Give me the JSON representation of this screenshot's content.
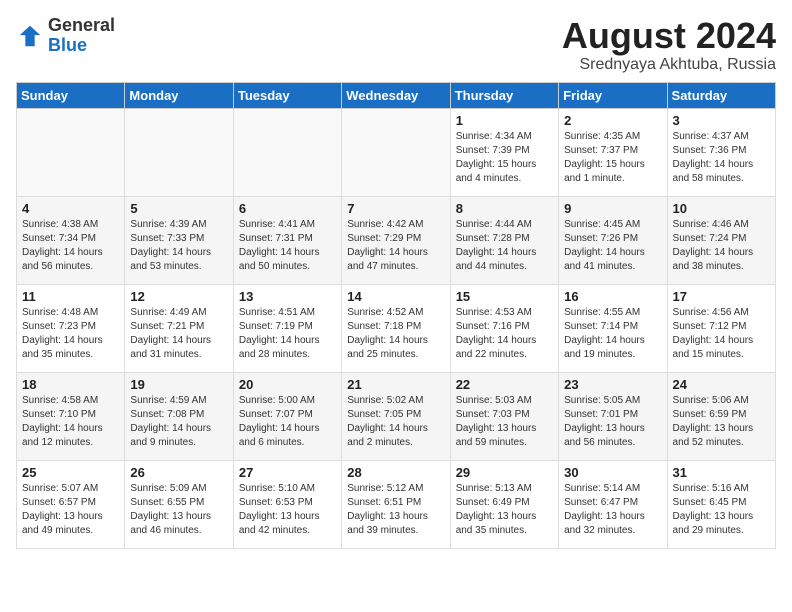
{
  "header": {
    "logo": {
      "general": "General",
      "blue": "Blue"
    },
    "month": "August 2024",
    "location": "Srednyaya Akhtuba, Russia"
  },
  "days_of_week": [
    "Sunday",
    "Monday",
    "Tuesday",
    "Wednesday",
    "Thursday",
    "Friday",
    "Saturday"
  ],
  "weeks": [
    [
      {
        "num": "",
        "info": ""
      },
      {
        "num": "",
        "info": ""
      },
      {
        "num": "",
        "info": ""
      },
      {
        "num": "",
        "info": ""
      },
      {
        "num": "1",
        "info": "Sunrise: 4:34 AM\nSunset: 7:39 PM\nDaylight: 15 hours\nand 4 minutes."
      },
      {
        "num": "2",
        "info": "Sunrise: 4:35 AM\nSunset: 7:37 PM\nDaylight: 15 hours\nand 1 minute."
      },
      {
        "num": "3",
        "info": "Sunrise: 4:37 AM\nSunset: 7:36 PM\nDaylight: 14 hours\nand 58 minutes."
      }
    ],
    [
      {
        "num": "4",
        "info": "Sunrise: 4:38 AM\nSunset: 7:34 PM\nDaylight: 14 hours\nand 56 minutes."
      },
      {
        "num": "5",
        "info": "Sunrise: 4:39 AM\nSunset: 7:33 PM\nDaylight: 14 hours\nand 53 minutes."
      },
      {
        "num": "6",
        "info": "Sunrise: 4:41 AM\nSunset: 7:31 PM\nDaylight: 14 hours\nand 50 minutes."
      },
      {
        "num": "7",
        "info": "Sunrise: 4:42 AM\nSunset: 7:29 PM\nDaylight: 14 hours\nand 47 minutes."
      },
      {
        "num": "8",
        "info": "Sunrise: 4:44 AM\nSunset: 7:28 PM\nDaylight: 14 hours\nand 44 minutes."
      },
      {
        "num": "9",
        "info": "Sunrise: 4:45 AM\nSunset: 7:26 PM\nDaylight: 14 hours\nand 41 minutes."
      },
      {
        "num": "10",
        "info": "Sunrise: 4:46 AM\nSunset: 7:24 PM\nDaylight: 14 hours\nand 38 minutes."
      }
    ],
    [
      {
        "num": "11",
        "info": "Sunrise: 4:48 AM\nSunset: 7:23 PM\nDaylight: 14 hours\nand 35 minutes."
      },
      {
        "num": "12",
        "info": "Sunrise: 4:49 AM\nSunset: 7:21 PM\nDaylight: 14 hours\nand 31 minutes."
      },
      {
        "num": "13",
        "info": "Sunrise: 4:51 AM\nSunset: 7:19 PM\nDaylight: 14 hours\nand 28 minutes."
      },
      {
        "num": "14",
        "info": "Sunrise: 4:52 AM\nSunset: 7:18 PM\nDaylight: 14 hours\nand 25 minutes."
      },
      {
        "num": "15",
        "info": "Sunrise: 4:53 AM\nSunset: 7:16 PM\nDaylight: 14 hours\nand 22 minutes."
      },
      {
        "num": "16",
        "info": "Sunrise: 4:55 AM\nSunset: 7:14 PM\nDaylight: 14 hours\nand 19 minutes."
      },
      {
        "num": "17",
        "info": "Sunrise: 4:56 AM\nSunset: 7:12 PM\nDaylight: 14 hours\nand 15 minutes."
      }
    ],
    [
      {
        "num": "18",
        "info": "Sunrise: 4:58 AM\nSunset: 7:10 PM\nDaylight: 14 hours\nand 12 minutes."
      },
      {
        "num": "19",
        "info": "Sunrise: 4:59 AM\nSunset: 7:08 PM\nDaylight: 14 hours\nand 9 minutes."
      },
      {
        "num": "20",
        "info": "Sunrise: 5:00 AM\nSunset: 7:07 PM\nDaylight: 14 hours\nand 6 minutes."
      },
      {
        "num": "21",
        "info": "Sunrise: 5:02 AM\nSunset: 7:05 PM\nDaylight: 14 hours\nand 2 minutes."
      },
      {
        "num": "22",
        "info": "Sunrise: 5:03 AM\nSunset: 7:03 PM\nDaylight: 13 hours\nand 59 minutes."
      },
      {
        "num": "23",
        "info": "Sunrise: 5:05 AM\nSunset: 7:01 PM\nDaylight: 13 hours\nand 56 minutes."
      },
      {
        "num": "24",
        "info": "Sunrise: 5:06 AM\nSunset: 6:59 PM\nDaylight: 13 hours\nand 52 minutes."
      }
    ],
    [
      {
        "num": "25",
        "info": "Sunrise: 5:07 AM\nSunset: 6:57 PM\nDaylight: 13 hours\nand 49 minutes."
      },
      {
        "num": "26",
        "info": "Sunrise: 5:09 AM\nSunset: 6:55 PM\nDaylight: 13 hours\nand 46 minutes."
      },
      {
        "num": "27",
        "info": "Sunrise: 5:10 AM\nSunset: 6:53 PM\nDaylight: 13 hours\nand 42 minutes."
      },
      {
        "num": "28",
        "info": "Sunrise: 5:12 AM\nSunset: 6:51 PM\nDaylight: 13 hours\nand 39 minutes."
      },
      {
        "num": "29",
        "info": "Sunrise: 5:13 AM\nSunset: 6:49 PM\nDaylight: 13 hours\nand 35 minutes."
      },
      {
        "num": "30",
        "info": "Sunrise: 5:14 AM\nSunset: 6:47 PM\nDaylight: 13 hours\nand 32 minutes."
      },
      {
        "num": "31",
        "info": "Sunrise: 5:16 AM\nSunset: 6:45 PM\nDaylight: 13 hours\nand 29 minutes."
      }
    ]
  ]
}
